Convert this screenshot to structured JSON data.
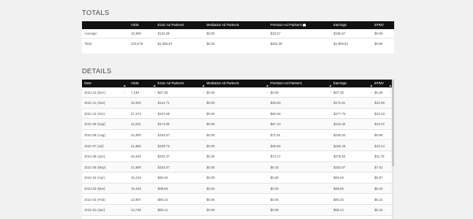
{
  "totals_title": "TOTALS",
  "details_title": "DETAILS",
  "totals": {
    "headers": [
      "",
      "Visits",
      "Ezoic Ad Partners",
      "Mediation Ad Partners",
      "Premium Ad Partners",
      "Earnings",
      "EPMV"
    ],
    "rows": [
      [
        "Average:",
        "18,389",
        "$132.99",
        "$0.00",
        "$33.57",
        "$166.57",
        "$9.06"
      ],
      [
        "Total:",
        "220,679",
        "$1,595.87",
        "$0.03",
        "$402.90",
        "$1,998.81",
        "$9.06"
      ]
    ]
  },
  "details": {
    "headers": [
      "Date",
      "Visits",
      "Ezoic Ad Partners",
      "Mediation Ad Partners",
      "Premium Ad Partners",
      "Earnings",
      "EPMV"
    ],
    "rows": [
      [
        "2021-12 (Dec)",
        "7,184",
        "$67.38",
        "$0.00",
        "$0.00",
        "$67.38",
        "$9.38"
      ],
      [
        "2021-11 (Nov)",
        "16,000",
        "$144.71",
        "$0.00",
        "$30.80",
        "$175.51",
        "$10.99"
      ],
      [
        "2021-10 (Oct)",
        "27,273",
        "$197.69",
        "$0.00",
        "$80.06",
        "$277.75",
        "$10.18"
      ],
      [
        "2021-09 (Sep)",
        "24,031",
        "$174.90",
        "$0.00",
        "$67.10",
        "$242.00",
        "$10.07"
      ],
      [
        "2021-08 (Aug)",
        "22,390",
        "$153.67",
        "$0.00",
        "$71.91",
        "$225.62",
        "$9.99"
      ],
      [
        "2021-07 (Jul)",
        "21,685",
        "$159.73",
        "$0.00",
        "$66.56",
        "$226.29",
        "$10.44"
      ],
      [
        "2021-06 (Jun)",
        "23,446",
        "$202.37",
        "$0.00",
        "$74.17",
        "$276.54",
        "$11.79"
      ],
      [
        "2021-05 (May)",
        "21,689",
        "$153.57",
        "$0.00",
        "$9.10",
        "$162.67",
        "$7.51"
      ],
      [
        "2021-04 (Apr)",
        "15,419",
        "$90.49",
        "$0.00",
        "$0.00",
        "$90.49",
        "$5.87"
      ],
      [
        "2021-03 (Mar)",
        "16,446",
        "$98.89",
        "$0.00",
        "$0.00",
        "$98.89",
        "$6.40"
      ],
      [
        "2021-02 (Feb)",
        "12,907",
        "$80.33",
        "$0.00",
        "$0.00",
        "$80.33",
        "$6.22"
      ],
      [
        "2021-01 (Jan)",
        "12,738",
        "$69.14",
        "$0.00",
        "$0.00",
        "$69.14",
        "$5.43"
      ]
    ]
  }
}
